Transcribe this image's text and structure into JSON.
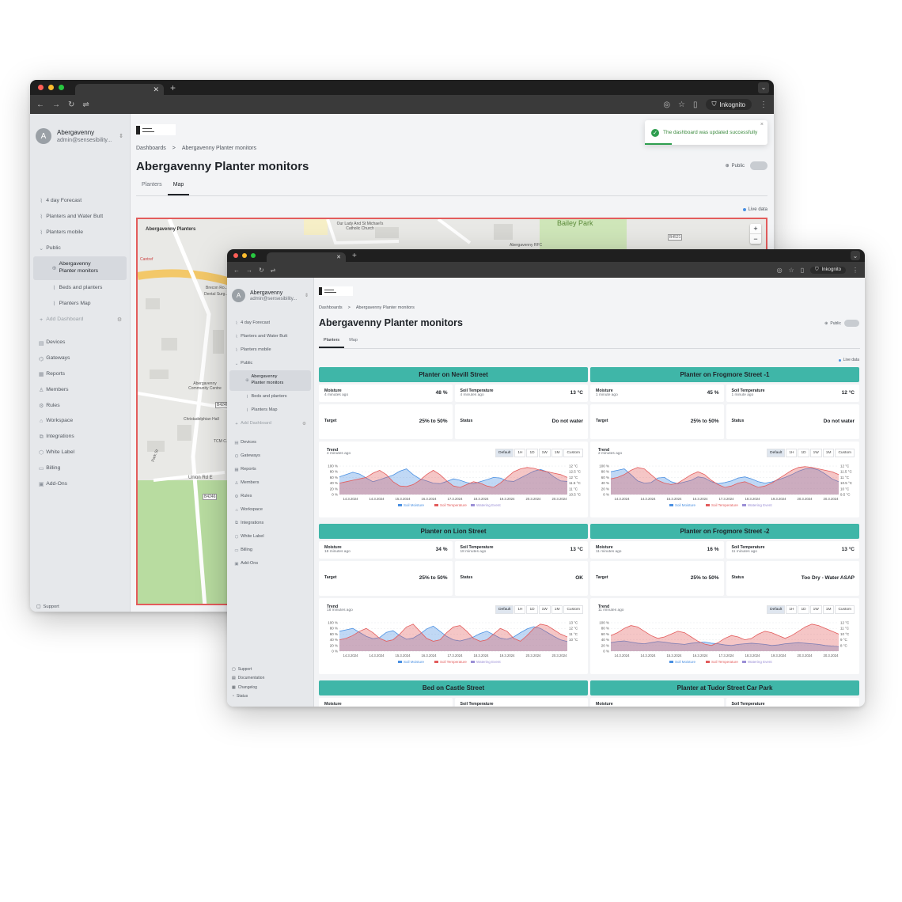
{
  "colors": {
    "accent": "#3fb6a8",
    "map_border": "#e35c5c",
    "moisture": "#4a90e2",
    "temperature": "#e35c5c",
    "watering": "#9b8fd6"
  },
  "account": {
    "avatar": "A",
    "name": "Abergavenny",
    "email": "admin@sensesibility..."
  },
  "sidebar": {
    "items": [
      {
        "label": "4 day Forecast",
        "icon": "chart-icon"
      },
      {
        "label": "Planters and Water Butt",
        "icon": "chart-icon"
      },
      {
        "label": "Planters mobile",
        "icon": "chart-icon"
      },
      {
        "label": "Public",
        "icon": "chevron-down-icon"
      },
      {
        "label": "Abergavenny Planter monitors",
        "icon": "globe-icon"
      },
      {
        "label": "Beds and planters",
        "icon": "chart-icon"
      },
      {
        "label": "Planters Map",
        "icon": "chart-icon"
      },
      {
        "label": "Add Dashboard",
        "icon": "plus-icon"
      }
    ],
    "main": [
      {
        "label": "Devices",
        "icon": "devices-icon"
      },
      {
        "label": "Gateways",
        "icon": "gateway-icon"
      },
      {
        "label": "Reports",
        "icon": "report-icon"
      },
      {
        "label": "Members",
        "icon": "members-icon"
      },
      {
        "label": "Rules",
        "icon": "rules-icon"
      },
      {
        "label": "Workspace",
        "icon": "workspace-icon"
      },
      {
        "label": "Integrations",
        "icon": "integrations-icon"
      },
      {
        "label": "White Label",
        "icon": "tag-icon"
      },
      {
        "label": "Billing",
        "icon": "billing-icon"
      },
      {
        "label": "Add-Ons",
        "icon": "addons-icon"
      }
    ],
    "footer": [
      {
        "label": "Support",
        "icon": "chat-icon"
      },
      {
        "label": "Documentation",
        "icon": "book-icon"
      },
      {
        "label": "Changelog",
        "icon": "calendar-icon"
      },
      {
        "label": "Status",
        "icon": "status-icon"
      }
    ]
  },
  "browser": {
    "incognito": "Inkognito"
  },
  "header": {
    "breadcrumb_root": "Dashboards",
    "breadcrumb_sep": ">",
    "breadcrumb_current": "Abergavenny Planter monitors",
    "title": "Abergavenny Planter monitors",
    "public": "Public",
    "tabs": [
      "Planters",
      "Map"
    ],
    "live": "Live data"
  },
  "toast": {
    "message": "The dashboard was updated successfully",
    "close": "×"
  },
  "map": {
    "labels": [
      "Abergavenny Planters",
      "Our Lady And St Michael's Catholic Church",
      "Bailey Park",
      "B4521",
      "Abergavenny RFC",
      "Cantref",
      "Brecon Ro...",
      "Dental Surg...",
      "Abergavenny Community Centre",
      "Christadelphian Hall",
      "TCM C...",
      "Park St",
      "Union Rd E",
      "B4246",
      "B4246"
    ],
    "zoom_in": "+",
    "zoom_out": "−"
  },
  "chart_labels": {
    "trend": "Trend",
    "ranges": [
      "Default",
      "1H",
      "1D",
      "1W",
      "1M",
      "Custom"
    ],
    "x_ticks": [
      "14.3.2024",
      "14.3.2024",
      "15.3.2024",
      "16.3.2024",
      "17.3.2024",
      "18.3.2024",
      "19.3.2024",
      "20.3.2024",
      "20.3.2024"
    ],
    "y_left": [
      "100 %",
      "80 %",
      "60 %",
      "40 %",
      "20 %",
      "0 %"
    ],
    "legend": [
      "Soil Moisture",
      "Soil Temperature",
      "Watering Event"
    ]
  },
  "cards": [
    {
      "title": "Planter on Nevill Street",
      "moisture_label": "Moisture",
      "moisture_time": "4 minutes ago",
      "moisture": "48 %",
      "temp_label": "Soil Temperature",
      "temp_time": "4 minutes ago",
      "temp": "13 °C",
      "target_label": "Target",
      "target": "25% to 50%",
      "status_label": "Status",
      "status": "Do not water",
      "trend_time": "4 minutes ago",
      "y_right": [
        "12 °C",
        "12.5 °C",
        "12 °C",
        "11.5 °C",
        "11 °C",
        "10.5 °C"
      ]
    },
    {
      "title": "Planter on Frogmore Street -1",
      "moisture_label": "Moisture",
      "moisture_time": "1 minute ago",
      "moisture": "45 %",
      "temp_label": "Soil Temperature",
      "temp_time": "1 minute ago",
      "temp": "12 °C",
      "target_label": "Target",
      "target": "25% to 50%",
      "status_label": "Status",
      "status": "Do not water",
      "trend_time": "2 minutes ago",
      "y_right": [
        "12 °C",
        "11.5 °C",
        "11 °C",
        "10.5 °C",
        "10 °C",
        "9.5 °C"
      ]
    },
    {
      "title": "Planter on Lion Street",
      "moisture_label": "Moisture",
      "moisture_time": "18 minutes ago",
      "moisture": "34 %",
      "temp_label": "Soil Temperature",
      "temp_time": "18 minutes ago",
      "temp": "13 °C",
      "target_label": "Target",
      "target": "25% to 50%",
      "status_label": "Status",
      "status": "OK",
      "trend_time": "18 minutes ago",
      "y_right": [
        "13 °C",
        "12 °C",
        "11 °C",
        "10 °C",
        "",
        ""
      ]
    },
    {
      "title": "Planter on Frogmore Street -2",
      "moisture_label": "Moisture",
      "moisture_time": "11 minutes ago",
      "moisture": "16 %",
      "temp_label": "Soil Temperature",
      "temp_time": "11 minutes ago",
      "temp": "13 °C",
      "target_label": "Target",
      "target": "25% to 50%",
      "status_label": "Status",
      "status": "Too Dry - Water ASAP",
      "trend_time": "11 minutes ago",
      "y_right": [
        "12 °C",
        "11 °C",
        "10 °C",
        "9 °C",
        "8 °C",
        ""
      ]
    },
    {
      "title": "Bed on Castle Street",
      "moisture_label": "Moisture",
      "temp_label": "Soil Temperature"
    },
    {
      "title": "Planter at Tudor Street Car Park",
      "moisture_label": "Moisture",
      "temp_label": "Soil Temperature"
    }
  ]
}
